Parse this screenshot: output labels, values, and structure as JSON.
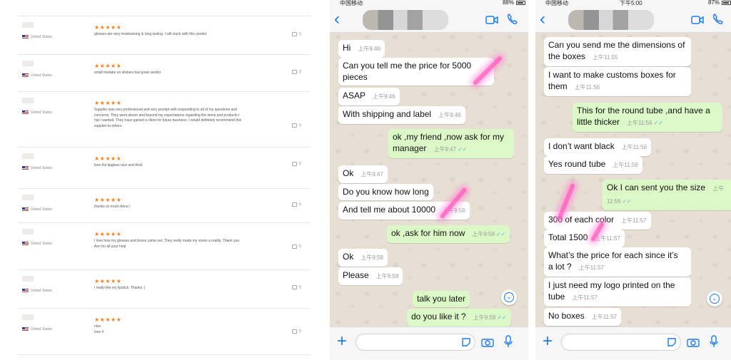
{
  "reviews": [
    {
      "country": "United States",
      "stars": "★★★★★",
      "text": "glosses are very moisturizing & long lasting. I will stuck with this vendor",
      "likes": "0"
    },
    {
      "country": "United States",
      "stars": "★★★★★",
      "text": "small mistake on stickers but great vendor",
      "likes": "0"
    },
    {
      "country": "United States",
      "stars": "★★★★★",
      "text": "Supplier was very professional and very prompt with responding to all of my questions and\nconcerns. They went above and beyond my expectations regarding the items and products t\nhat I wanted. They have gained a client for future business. I would definitely recommend this\nsupplier to others.",
      "likes": "0"
    },
    {
      "country": "United States",
      "stars": "★★★★★",
      "text": "love the lipgloss nice and thick",
      "likes": "0"
    },
    {
      "country": "United States",
      "stars": "★★★★★",
      "text": "thanks so much Anna !",
      "likes": "0"
    },
    {
      "country": "United States",
      "stars": "★★★★★",
      "text": "I love how my glosses and boxes came out. They really made my vision a reality. Thank you\nAnn for all your help",
      "likes": "0"
    },
    {
      "country": "United States",
      "stars": "★★★★★",
      "text": "I really like my lipstick. Thanks :)",
      "likes": "0"
    },
    {
      "country": "United States",
      "stars": "★★★★★",
      "text": "nice\nlove it",
      "likes": "0"
    }
  ],
  "chat1": {
    "status": {
      "carrier": "中国移动",
      "time": "",
      "battery": "88%"
    },
    "messages": [
      {
        "dir": "in",
        "text": "Hi",
        "time": "上午9:46"
      },
      {
        "dir": "in",
        "text": "Can you tell me the price for 5000\npieces",
        "time": "上午9:46"
      },
      {
        "dir": "in",
        "text": "ASAP",
        "time": "上午9:46"
      },
      {
        "dir": "in",
        "text": "With shipping and label",
        "time": "上午9:46"
      },
      {
        "dir": "out",
        "text": "ok ,my friend ,now ask for my\nmanager",
        "time": "上午9:47"
      },
      {
        "dir": "in",
        "text": "Ok",
        "time": "上午9:47"
      },
      {
        "dir": "in",
        "text": "Do you know how long",
        "time": "上午9:56"
      },
      {
        "dir": "in",
        "text": "And tell me about 10000",
        "time": "上午9:56"
      },
      {
        "dir": "out",
        "text": "ok ,ask for him now",
        "time": "上午9:58"
      },
      {
        "dir": "in",
        "text": "Ok",
        "time": "上午9:58"
      },
      {
        "dir": "in",
        "text": "Please",
        "time": "上午9:58"
      },
      {
        "dir": "out",
        "text": "talk you later",
        "time": "上午9:59"
      },
      {
        "dir": "out",
        "text": "do you like it ?",
        "time": "上午9:59"
      }
    ]
  },
  "chat2": {
    "status": {
      "carrier": "中国移动",
      "time": "下午5:00",
      "battery": "87%"
    },
    "messages": [
      {
        "dir": "in",
        "text": "Can you send me the dimensions of\nthe boxes",
        "time": "上午11:55"
      },
      {
        "dir": "in",
        "text": "I want to make customs boxes for\nthem",
        "time": "上午11:56"
      },
      {
        "dir": "out",
        "text": "This for the round tube ,and have a\nlittle thicker",
        "time": "上午11:56"
      },
      {
        "dir": "in",
        "text": "I don’t want black",
        "time": "上午11:56"
      },
      {
        "dir": "in",
        "text": "Yes round tube",
        "time": "上午11:56"
      },
      {
        "dir": "out",
        "text": "Ok I can sent you the size",
        "time": "上午11:56"
      },
      {
        "dir": "in",
        "text": "300 of each color",
        "time": "上午11:57"
      },
      {
        "dir": "in",
        "text": "Total 1500",
        "time": "上午11:57"
      },
      {
        "dir": "in",
        "text": "What’s the price for each since it’s\na lot ?",
        "time": "上午11:57"
      },
      {
        "dir": "in",
        "text": "I just need my logo printed on the\ntube",
        "time": "上午11:57"
      },
      {
        "dir": "in",
        "text": "No boxes",
        "time": "上午11:57"
      }
    ]
  },
  "icons": {
    "back": "chevron-left-icon",
    "video": "video-call-icon",
    "phone": "phone-icon",
    "plus": "plus-icon",
    "sticker": "sticker-icon",
    "camera": "camera-icon",
    "mic": "microphone-icon",
    "scroll": "scroll-down-icon",
    "like": "thumbs-up-icon",
    "flag": "us-flag-icon"
  },
  "colors": {
    "accent": "#1a7bf2",
    "star": "#f5811d",
    "outgoing": "#dcf8c6",
    "incoming": "#ffffff",
    "wallpaper": "#e7dfd4",
    "read_ticks": "#4fb6ec"
  }
}
